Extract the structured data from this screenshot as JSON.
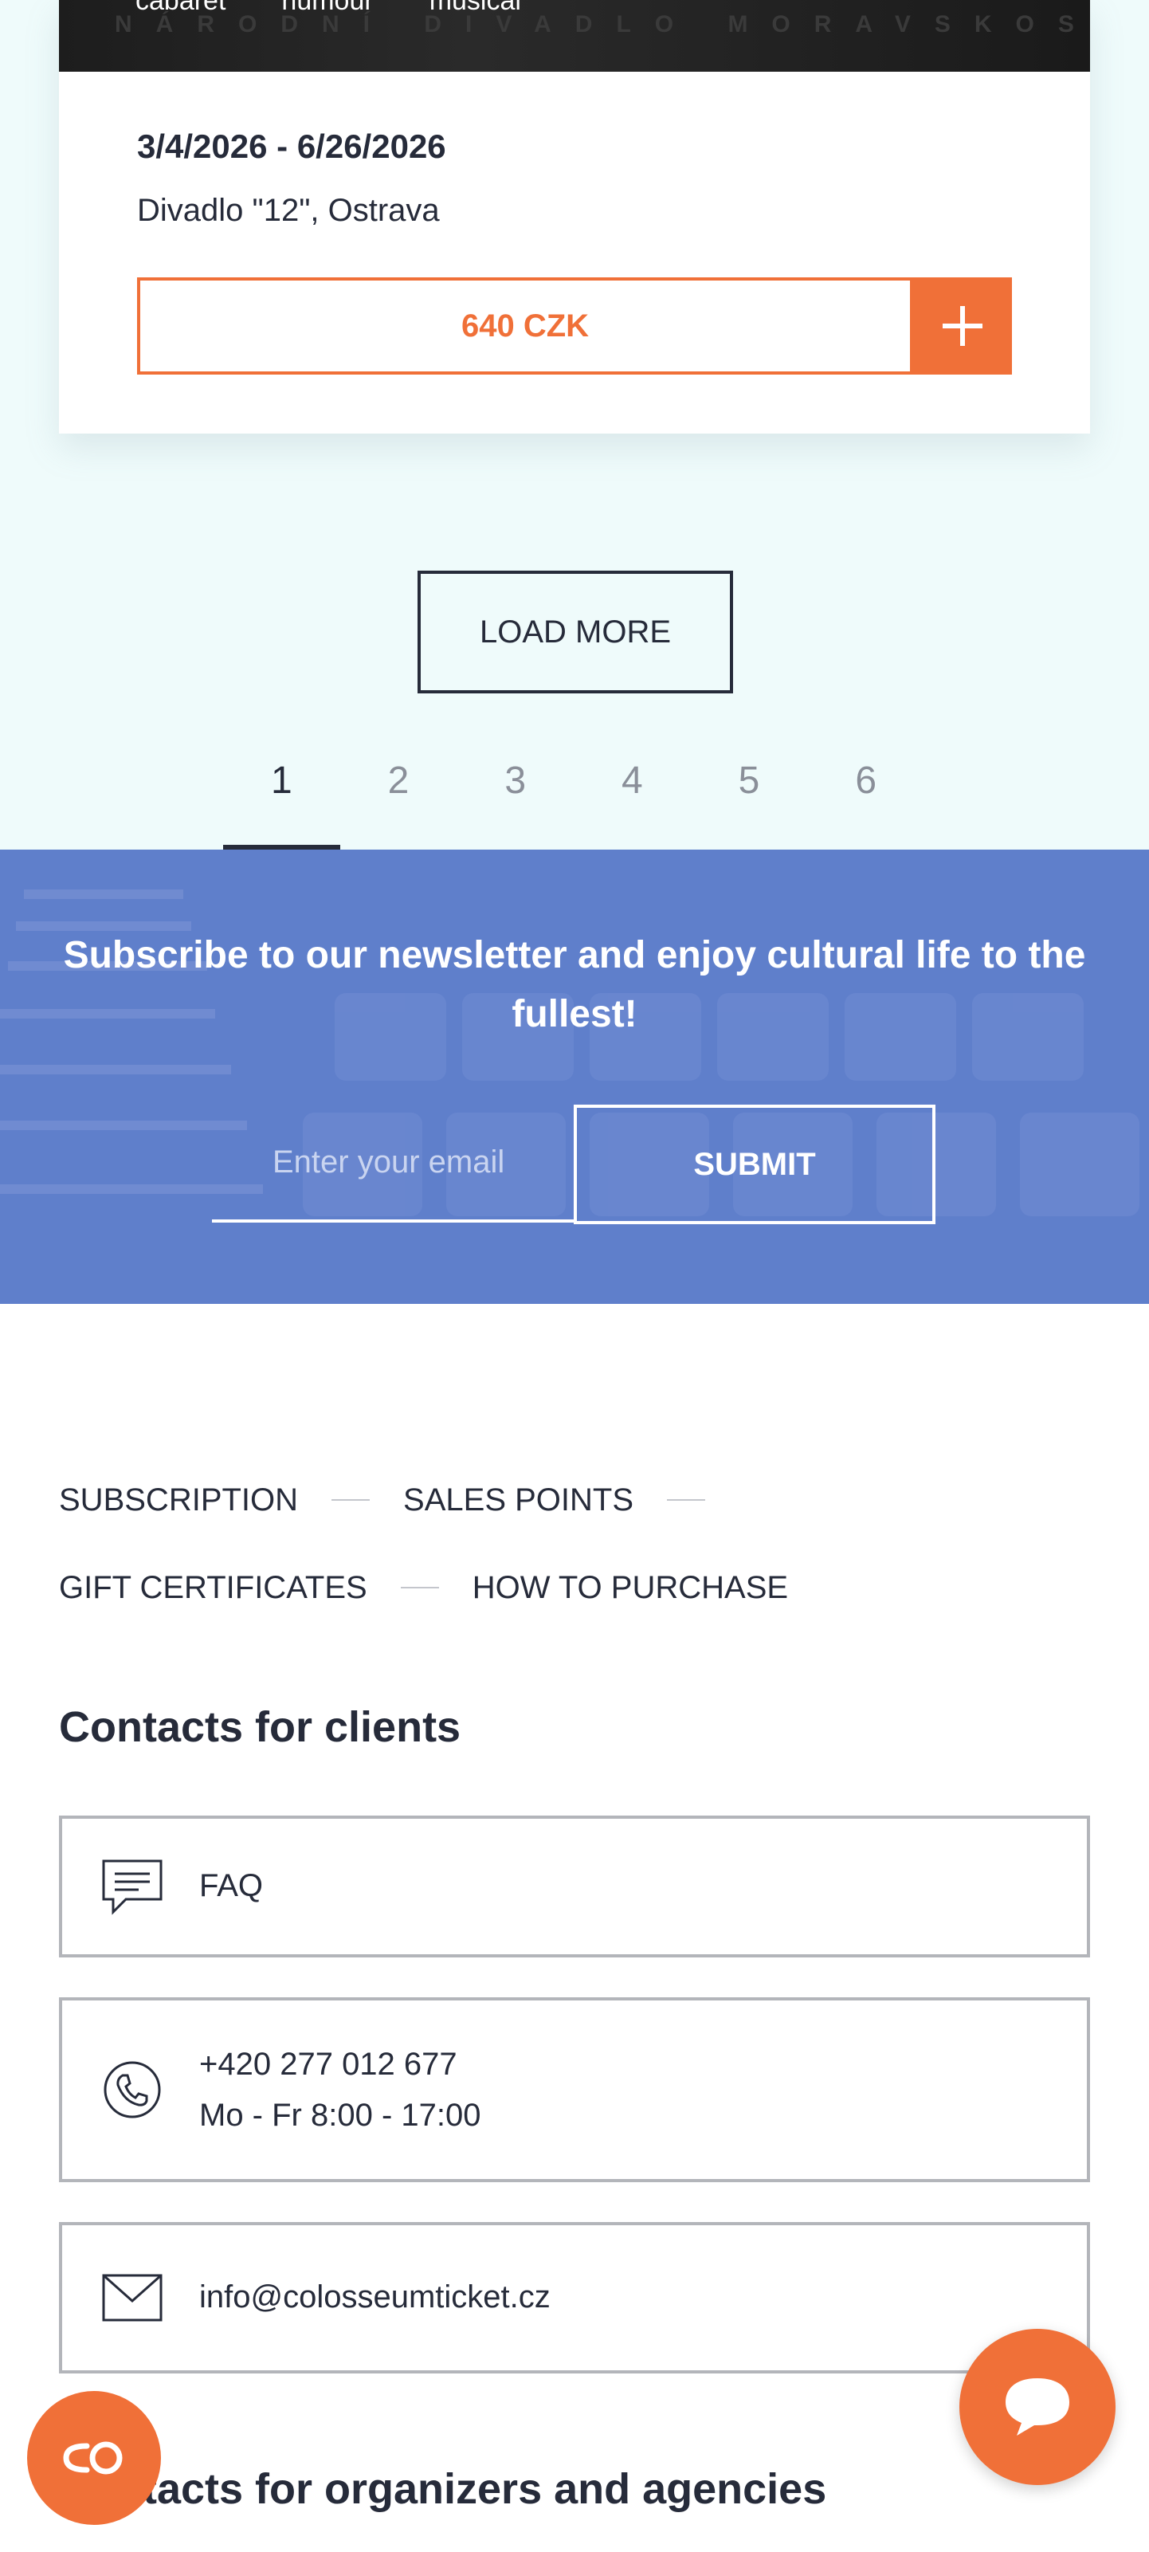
{
  "event": {
    "tags": [
      "cabaret",
      "humour",
      "musical"
    ],
    "watermark": "NÁRODNÍ DIVADLO MORAVSKOSLEZ",
    "date_range": "3/4/2026 - 6/26/2026",
    "venue": "Divadlo \"12\", Ostrava",
    "price_label": "640 CZK",
    "add_icon": "plus-icon"
  },
  "load_more_label": "LOAD MORE",
  "pagination": {
    "pages": [
      "1",
      "2",
      "3",
      "4",
      "5",
      "6"
    ],
    "active_page": "1"
  },
  "newsletter": {
    "title": "Subscribe to our newsletter and enjoy cultural life to the fullest!",
    "email_placeholder": "Enter your email",
    "submit_label": "SUBMIT"
  },
  "footer_links": {
    "row1": [
      "SUBSCRIPTION",
      "SALES POINTS"
    ],
    "row2": [
      "GIFT CERTIFICATES",
      "HOW TO PURCHASE"
    ]
  },
  "contacts_clients": {
    "heading": "Contacts for clients",
    "faq": {
      "label": "FAQ",
      "icon": "chat-icon"
    },
    "phone": {
      "number": "+420 277 012 677",
      "hours": "Mo - Fr 8:00 - 17:00",
      "icon": "phone-icon"
    },
    "email": {
      "address": "info@colosseumticket.cz",
      "icon": "mail-icon"
    }
  },
  "contacts_organizers": {
    "heading": "Contacts for organizers and agencies"
  },
  "fabs": {
    "left_icon": "cookie-consent-icon",
    "right_icon": "chat-bubble-icon"
  },
  "colors": {
    "accent": "#f07038",
    "dark_text": "#262b3a",
    "newsletter_bg": "#5f7fcb",
    "light_bg": "#effbfb"
  }
}
